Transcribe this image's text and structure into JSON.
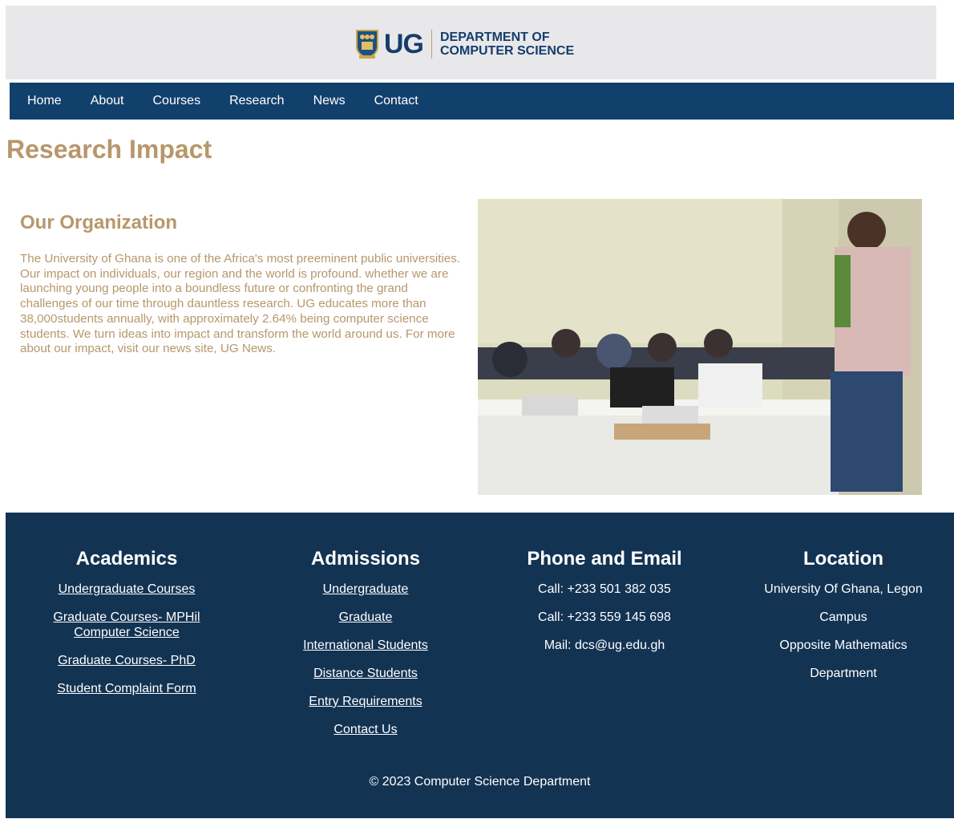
{
  "header": {
    "brand_short": "UG",
    "dept_line1": "DEPARTMENT OF",
    "dept_line2": "COMPUTER SCIENCE"
  },
  "nav": {
    "items": [
      "Home",
      "About",
      "Courses",
      "Research",
      "News",
      "Contact"
    ]
  },
  "page": {
    "title": "Research Impact"
  },
  "organization": {
    "title": "Our Organization",
    "body": "The University of Ghana is one of the Africa's most preeminent public universities. Our impact on individuals, our region and the world is profound. whether we are launching young people into a boundless future or confronting the grand challenges of our time through dauntless research. UG educates more than 38,000students annually, with approximately 2.64% being computer science students. We turn ideas into impact and transform the world around us. For more about our impact, visit our news site, UG News."
  },
  "footer": {
    "academics": {
      "title": "Academics",
      "links": [
        "Undergraduate Courses",
        "Graduate Courses- MPHil Computer Science",
        "Graduate Courses- PhD",
        "Student Complaint Form"
      ]
    },
    "admissions": {
      "title": "Admissions",
      "links": [
        "Undergraduate",
        "Graduate",
        "International Students",
        "Distance Students",
        "Entry Requirements",
        "Contact Us"
      ]
    },
    "contact": {
      "title": "Phone and Email",
      "lines": [
        "Call: +233 501 382 035",
        "Call: +233 559 145 698",
        "Mail: dcs@ug.edu.gh"
      ]
    },
    "location": {
      "title": "Location",
      "lines": [
        "University Of Ghana, Legon",
        "Campus",
        "Opposite Mathematics",
        "Department"
      ]
    },
    "copyright": "© 2023 Computer Science Department"
  },
  "colors": {
    "navy": "#12406c",
    "footer": "#133353",
    "gold": "#b7976b",
    "header_bg": "#e8e8ea"
  }
}
